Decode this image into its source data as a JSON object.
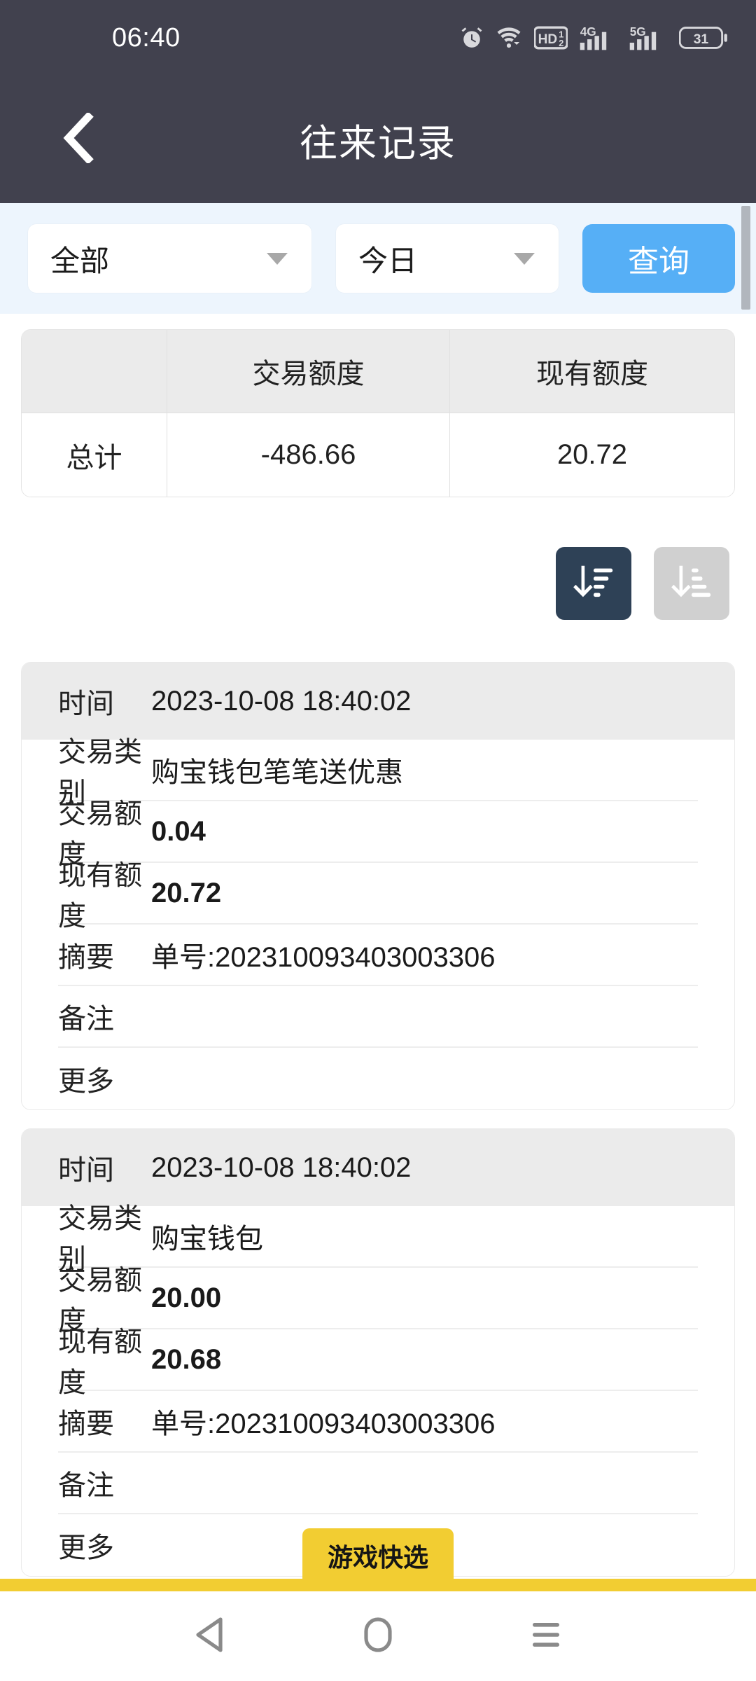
{
  "status_bar": {
    "time": "06:40",
    "icons": [
      "alarm-icon",
      "wifi-icon",
      "hd-volte-icon",
      "4g-signal-icon",
      "5g-signal-icon",
      "battery-icon"
    ],
    "battery_level": "31",
    "hd_label": "HD",
    "hd_sub": "1",
    "hd_sub2": "2",
    "net_4g": "4G",
    "net_5g": "5G",
    "bg_color": "#41414e"
  },
  "app_bar": {
    "title": "往来记录",
    "back_icon": "chevron-left-icon",
    "bg_color": "#41414e"
  },
  "filter_bar": {
    "bg_color": "#edf5fd",
    "type_select": {
      "value": "全部",
      "caret_icon": "chevron-down-icon"
    },
    "date_select": {
      "value": "今日",
      "caret_icon": "chevron-down-icon"
    },
    "query_button": {
      "label": "查询",
      "color": "#56aff6"
    },
    "scrollbar_color": "#b1b6bd"
  },
  "summary_table": {
    "headers": [
      "",
      "交易额度",
      "现有额度"
    ],
    "rows": [
      {
        "label": "总计",
        "transaction_amount": "-486.66",
        "current_balance": "20.72"
      }
    ],
    "header_bg": "#ebebeb"
  },
  "sort_controls": {
    "descending": {
      "icon": "sort-descending-icon",
      "active": true,
      "color": "#2e4156"
    },
    "ascending": {
      "icon": "sort-ascending-icon",
      "active": false,
      "color": "#d0d0d0"
    }
  },
  "transactions": [
    {
      "time_label": "时间",
      "time_value": "2023-10-08 18:40:02",
      "rows": [
        {
          "label": "交易类别",
          "value": "购宝钱包笔笔送优惠",
          "bold": false
        },
        {
          "label": "交易额度",
          "value": "0.04",
          "bold": true
        },
        {
          "label": "现有额度",
          "value": "20.72",
          "bold": true
        },
        {
          "label": "摘要",
          "value": "单号:202310093403003306",
          "bold": false
        },
        {
          "label": "备注",
          "value": "",
          "bold": false
        },
        {
          "label": "更多",
          "value": "",
          "bold": false
        }
      ]
    },
    {
      "time_label": "时间",
      "time_value": "2023-10-08 18:40:02",
      "rows": [
        {
          "label": "交易类别",
          "value": "购宝钱包",
          "bold": false
        },
        {
          "label": "交易额度",
          "value": "20.00",
          "bold": true
        },
        {
          "label": "现有额度",
          "value": "20.68",
          "bold": true
        },
        {
          "label": "摘要",
          "value": "单号:202310093403003306",
          "bold": false
        },
        {
          "label": "备注",
          "value": "",
          "bold": false
        },
        {
          "label": "更多",
          "value": "",
          "bold": false
        }
      ]
    }
  ],
  "game_tab": {
    "label": "游戏快选",
    "color": "#f2cd32"
  },
  "nav_bar": {
    "back_icon": "triangle-back-icon",
    "home_icon": "home-pill-icon",
    "recents_icon": "hamburger-recents-icon"
  }
}
